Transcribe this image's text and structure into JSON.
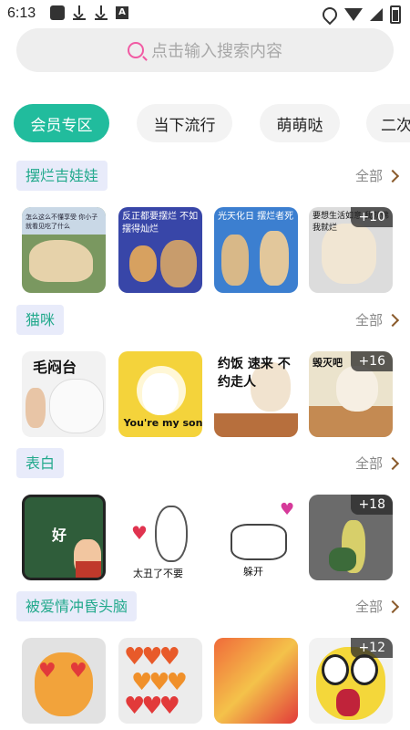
{
  "status": {
    "time": "6:13",
    "letter_icon": "A"
  },
  "search": {
    "placeholder": "点击输入搜索内容"
  },
  "tabs": [
    {
      "label": "会员专区",
      "active": true
    },
    {
      "label": "当下流行",
      "active": false
    },
    {
      "label": "萌萌哒",
      "active": false
    },
    {
      "label": "二次",
      "active": false
    }
  ],
  "sections": [
    {
      "title": "摆烂吉娃娃",
      "more": "全部",
      "thumbs": [
        {
          "caption": "怎么这么不懂享受 你小子就看见吃了什么",
          "bg": "#7a9860"
        },
        {
          "caption": "反正都要摆烂 不如摆得灿烂",
          "bg": "#3846a8"
        },
        {
          "caption": "光天化日 摆烂者死",
          "bg": "#3c7fd0"
        },
        {
          "caption": "要想生活如意 我就佛 我就烂",
          "bg": "#dcdcdc",
          "badge": "+10"
        }
      ]
    },
    {
      "title": "猫咪",
      "more": "全部",
      "thumbs": [
        {
          "caption": "毛闷台",
          "bg": "#f2f2f2"
        },
        {
          "caption": "You're my son",
          "bg": "#f4d33b"
        },
        {
          "caption": "约饭 速来 不约走人",
          "bg": "#ffffff"
        },
        {
          "caption": "毁灭吧",
          "bg": "#ebe3cc",
          "badge": "+16"
        }
      ]
    },
    {
      "title": "表白",
      "more": "全部",
      "thumbs": [
        {
          "caption": "好",
          "bg": "#2f5d3a"
        },
        {
          "caption": "太丑了不要",
          "bg": "#ffffff"
        },
        {
          "caption": "躲开",
          "bg": "#ffffff"
        },
        {
          "caption": "",
          "bg": "#6b6b6b",
          "badge": "+18"
        }
      ]
    },
    {
      "title": "被爱情冲昏头脑",
      "more": "全部",
      "thumbs": [
        {
          "caption": "",
          "bg": "#e2e2e2"
        },
        {
          "caption": "",
          "bg": "#ececec"
        },
        {
          "caption": "",
          "bg": "#f0b79a"
        },
        {
          "caption": "",
          "bg": "#f2f2f2",
          "badge": "+12"
        }
      ]
    }
  ]
}
